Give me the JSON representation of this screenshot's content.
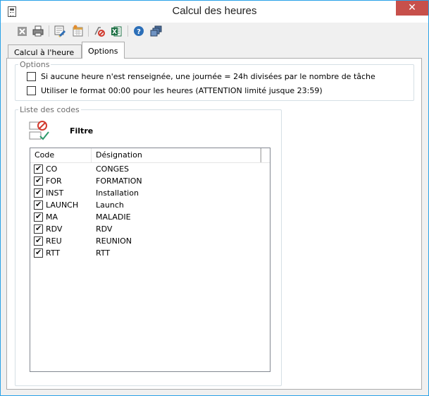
{
  "window": {
    "title": "Calcul des heures",
    "close_glyph": "✕"
  },
  "toolbar": {
    "buttons": [
      "close-doc-icon",
      "print-icon",
      "edit-hours-icon",
      "calendar-icon",
      "clear-icon",
      "excel-icon",
      "help-icon",
      "screens-icon"
    ]
  },
  "tabs": [
    {
      "label": "Calcul à l'heure",
      "active": false
    },
    {
      "label": "Options",
      "active": true
    }
  ],
  "options": {
    "legend": "Options",
    "items": [
      {
        "label": "Si aucune heure n'est renseignée, une journée = 24h divisées par le nombre de tâche",
        "checked": false
      },
      {
        "label": "Utiliser le format 00:00 pour les heures (ATTENTION limité jusque 23:59)",
        "checked": false
      }
    ]
  },
  "codes": {
    "legend": "Liste des codes",
    "filter_label": "Filtre",
    "columns": [
      "Code",
      "Désignation"
    ],
    "rows": [
      {
        "code": "CO",
        "designation": "CONGES",
        "checked": true
      },
      {
        "code": "FOR",
        "designation": "FORMATION",
        "checked": true
      },
      {
        "code": "INST",
        "designation": "Installation",
        "checked": true
      },
      {
        "code": "LAUNCH",
        "designation": "Launch",
        "checked": true
      },
      {
        "code": "MA",
        "designation": "MALADIE",
        "checked": true
      },
      {
        "code": "RDV",
        "designation": "RDV",
        "checked": true
      },
      {
        "code": "REU",
        "designation": "REUNION",
        "checked": true
      },
      {
        "code": "RTT",
        "designation": "RTT",
        "checked": true
      }
    ]
  },
  "colors": {
    "window_border": "#2aa2e8",
    "close_button": "#c7504b"
  }
}
